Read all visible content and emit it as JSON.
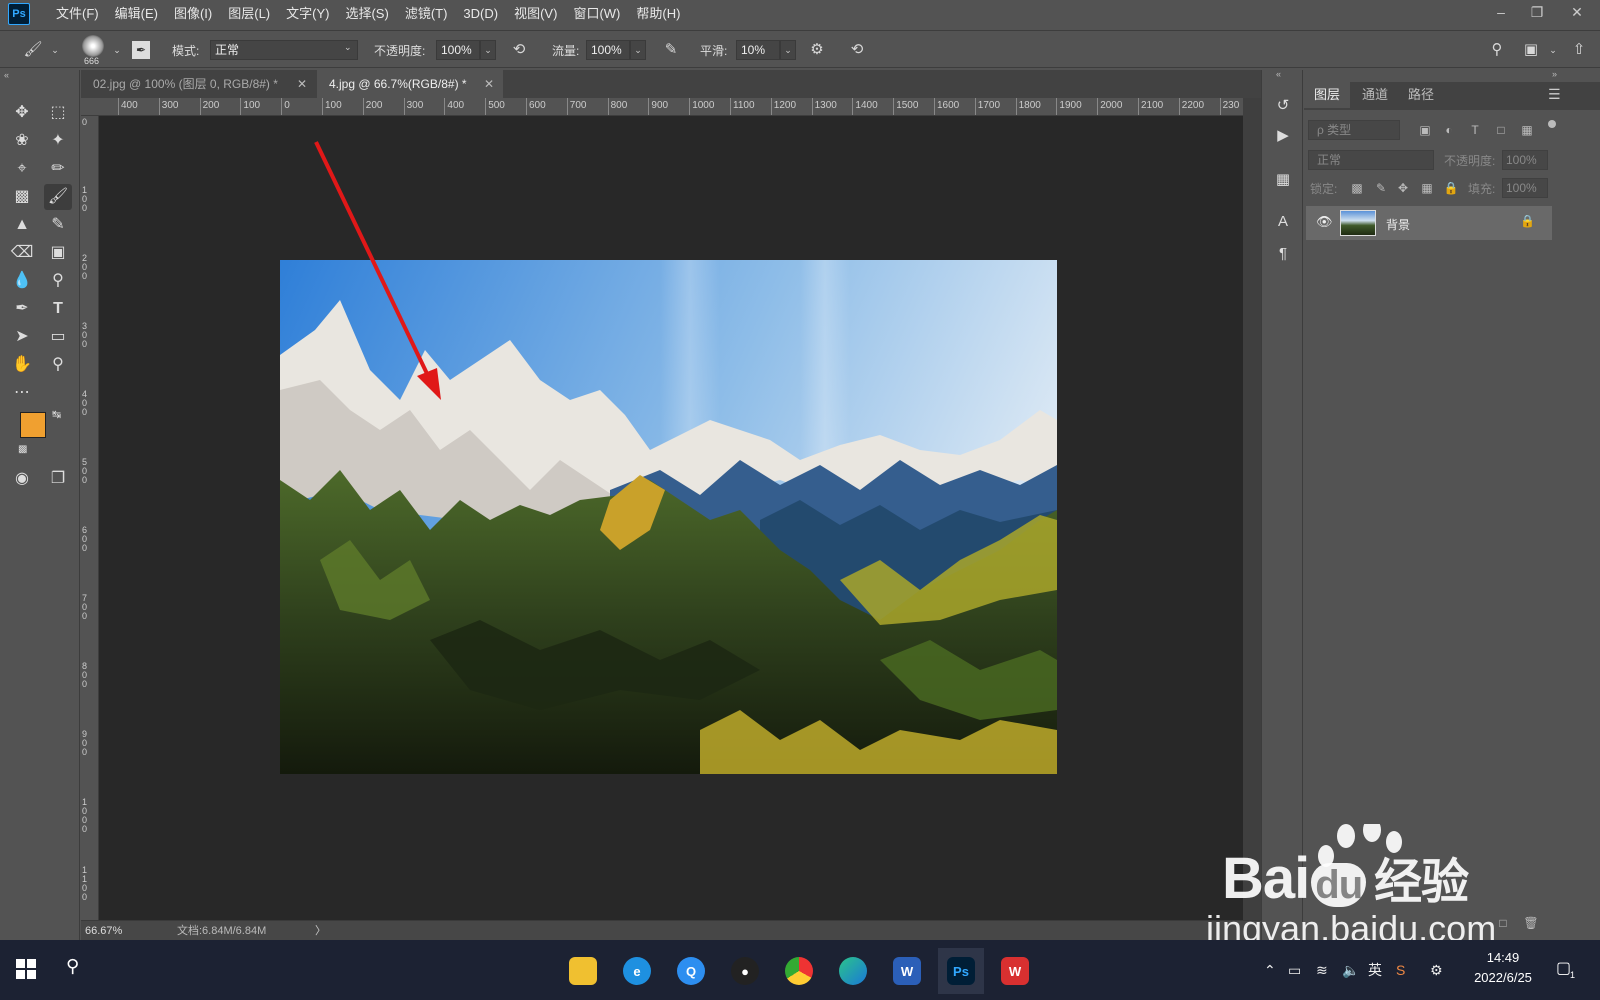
{
  "app": {
    "logo": "Ps"
  },
  "menu": [
    "文件(F)",
    "编辑(E)",
    "图像(I)",
    "图层(L)",
    "文字(Y)",
    "选择(S)",
    "滤镜(T)",
    "3D(D)",
    "视图(V)",
    "窗口(W)",
    "帮助(H)"
  ],
  "options": {
    "brush_size": "666",
    "mode_label": "模式:",
    "mode_value": "正常",
    "opacity_label": "不透明度:",
    "opacity_value": "100%",
    "flow_label": "流量:",
    "flow_value": "100%",
    "smooth_label": "平滑:",
    "smooth_value": "10%"
  },
  "tabs": [
    {
      "label": "02.jpg @ 100% (图层 0, RGB/8#) *",
      "active": false
    },
    {
      "label": "4.jpg @ 66.7%(RGB/8#) *",
      "active": true
    }
  ],
  "ruler": {
    "h_labels": [
      "400",
      "300",
      "200",
      "100",
      "0",
      "100",
      "200",
      "300",
      "400",
      "500",
      "600",
      "700",
      "800",
      "900",
      "1000",
      "1100",
      "1200",
      "1300",
      "1400",
      "1500",
      "1600",
      "1700",
      "1800",
      "1900",
      "2000",
      "2100",
      "2200",
      "230"
    ],
    "v_labels": [
      "0",
      "100",
      "200",
      "300",
      "400",
      "500",
      "600",
      "700",
      "800",
      "900",
      "1000",
      "1100"
    ]
  },
  "status": {
    "zoom": "66.67%",
    "doc": "文档:6.84M/6.84M",
    "arrow": "〉"
  },
  "colors": {
    "foreground": "#f0a030",
    "background": "#ffffff",
    "accent": "#31a8ff"
  },
  "layers_panel": {
    "tabs": [
      "图层",
      "通道",
      "路径"
    ],
    "filter_placeholder": "ρ 类型",
    "blend_mode": "正常",
    "opacity_label": "不透明度:",
    "opacity_value": "100%",
    "lock_label": "锁定:",
    "fill_label": "填充:",
    "fill_value": "100%",
    "layers": [
      {
        "name": "背景",
        "visible": true,
        "locked": true
      }
    ]
  },
  "taskbar": {
    "apps": [
      "file-explorer",
      "ie",
      "quick",
      "qq",
      "chrome",
      "edge",
      "word",
      "photoshop",
      "wps"
    ],
    "ime": "英",
    "time": "14:49",
    "date": "2022/6/25",
    "notification_count": "1"
  },
  "watermark": {
    "brand": "Bai",
    "brand2": "du",
    "suffix": "经验",
    "url": "jingyan.baidu.com"
  }
}
